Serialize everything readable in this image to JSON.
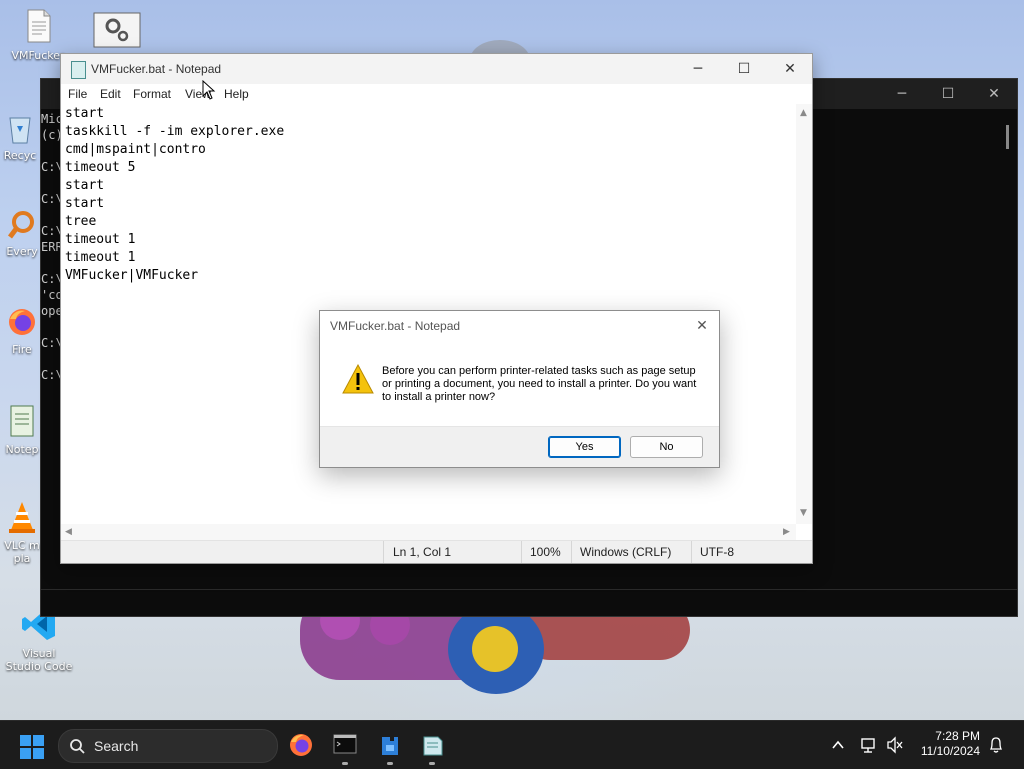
{
  "desktop": {
    "icons": [
      {
        "label": "VMFucker"
      },
      {
        "label": ""
      },
      {
        "label": "Recyc"
      },
      {
        "label": "Every"
      },
      {
        "label": "Fire"
      },
      {
        "label": "Notep"
      },
      {
        "label": "VLC m pla"
      },
      {
        "label": "Visual Studio Code"
      }
    ]
  },
  "cmd_window": {
    "lines": [
      "Mic",
      "(c)",
      "",
      "C:\\",
      "",
      "C:\\",
      "",
      "C:\\",
      "ERR",
      "",
      "C:\\",
      "'co",
      "ope",
      "",
      "C:\\",
      "",
      "C:\\"
    ]
  },
  "notepad": {
    "title": "VMFucker.bat - Notepad",
    "menu": [
      "File",
      "Edit",
      "Format",
      "View",
      "Help"
    ],
    "content_lines": [
      "start",
      "taskkill -f -im explorer.exe",
      "cmd|mspaint|contro",
      "timeout 5",
      "start",
      "start",
      "tree",
      "timeout 1",
      "timeout 1",
      "VMFucker|VMFucker"
    ],
    "status": {
      "position": "Ln 1, Col 1",
      "zoom": "100%",
      "line_ending": "Windows (CRLF)",
      "encoding": "UTF-8"
    }
  },
  "dialog": {
    "title": "VMFucker.bat - Notepad",
    "message": "Before you can perform printer-related tasks such as page setup or printing a document, you need to install a printer. Do you want to install a printer now?",
    "yes_label": "Yes",
    "no_label": "No"
  },
  "taskbar": {
    "search_label": "Search",
    "time": "7:28 PM",
    "date": "11/10/2024"
  }
}
